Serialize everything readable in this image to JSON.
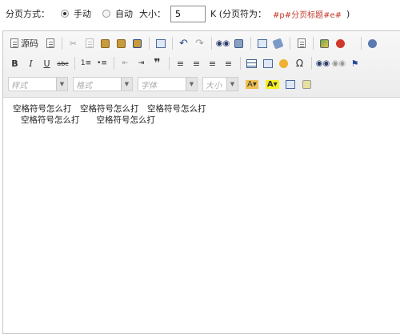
{
  "pager": {
    "label": "分页方式：",
    "manual": "手动",
    "auto": "自动",
    "size_label": "大小：",
    "size_value": "5",
    "unit_text": "K (分页符为：",
    "marker_text": "#p#分页标题#e#",
    "close_paren": ")"
  },
  "toolbar": {
    "source_label": "源码",
    "style_placeholder": "样式",
    "format_placeholder": "格式",
    "font_placeholder": "字体",
    "size_placeholder": "大小",
    "bold": "B",
    "italic": "I",
    "underline": "U",
    "strike": "abc",
    "omega": "Ω"
  },
  "content": {
    "line1": "空格符号怎么打　空格符号怎么打　空格符号怎么打",
    "line2": "空格符号怎么打　　空格符号怎么打"
  },
  "colors": {
    "marker": "#c0392b",
    "accent": "#3a5a8a"
  }
}
